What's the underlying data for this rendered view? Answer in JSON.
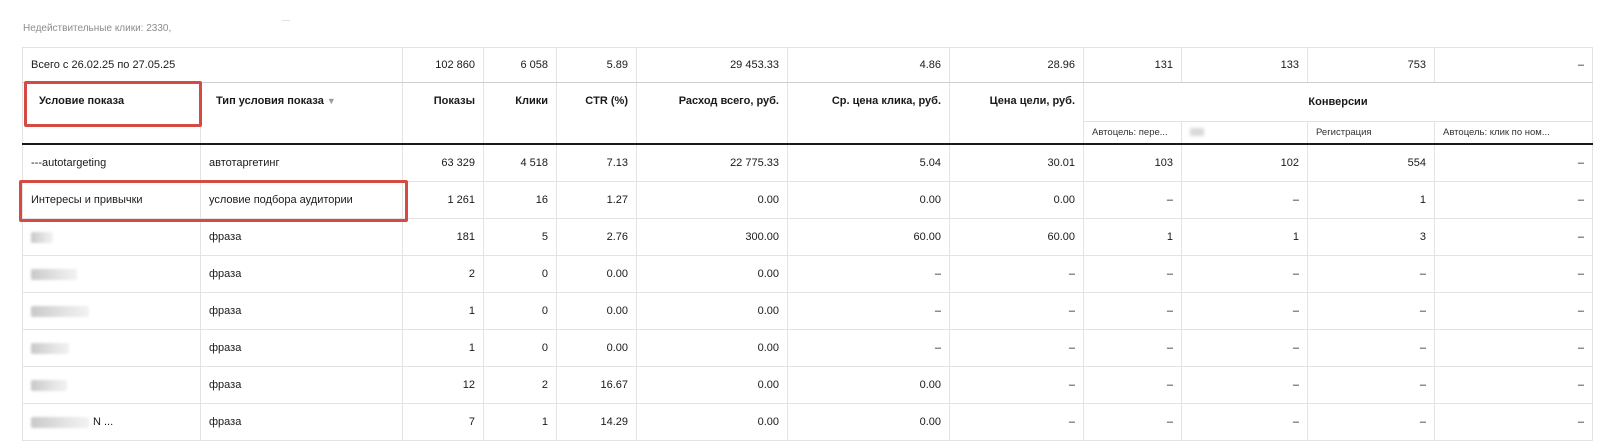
{
  "invalid_clicks": "Недействительные клики: 2330,",
  "totals": {
    "label": "Всего с 26.02.25 по 27.05.25",
    "impressions": "102 860",
    "clicks": "6 058",
    "ctr": "5.89",
    "spend": "29 453.33",
    "avg_cpc": "4.86",
    "goal_price": "28.96",
    "conv1": "131",
    "conv2": "133",
    "conv3": "753",
    "conv4": "–"
  },
  "headers": {
    "condition": "Условие показа",
    "condition_type": "Тип условия показа",
    "sort_arrow": "▼",
    "impressions": "Показы",
    "clicks": "Клики",
    "ctr": "CTR (%)",
    "spend": "Расход всего, руб.",
    "avg_cpc": "Ср. цена клика, руб.",
    "goal_price": "Цена цели, руб.",
    "conversions": "Конверсии",
    "conv_cols": [
      "Автоцель: пере...",
      "",
      "Регистрация",
      "Автоцель: клик по ном..."
    ]
  },
  "rows": [
    {
      "condition": "---autotargeting",
      "type": "автотаргетинг",
      "impressions": "63 329",
      "clicks": "4 518",
      "ctr": "7.13",
      "spend": "22 775.33",
      "avg_cpc": "5.04",
      "goal_price": "30.01",
      "c1": "103",
      "c2": "102",
      "c3": "554",
      "c4": "–"
    },
    {
      "condition": "Интересы и привычки",
      "type": "условие подбора аудитории",
      "impressions": "1 261",
      "clicks": "16",
      "ctr": "1.27",
      "spend": "0.00",
      "avg_cpc": "0.00",
      "goal_price": "0.00",
      "c1": "–",
      "c2": "–",
      "c3": "1",
      "c4": "–"
    },
    {
      "condition": "",
      "type": "фраза",
      "impressions": "181",
      "clicks": "5",
      "ctr": "2.76",
      "spend": "300.00",
      "avg_cpc": "60.00",
      "goal_price": "60.00",
      "c1": "1",
      "c2": "1",
      "c3": "3",
      "c4": "–"
    },
    {
      "condition": "",
      "type": "фраза",
      "impressions": "2",
      "clicks": "0",
      "ctr": "0.00",
      "spend": "0.00",
      "avg_cpc": "–",
      "goal_price": "–",
      "c1": "–",
      "c2": "–",
      "c3": "–",
      "c4": "–"
    },
    {
      "condition": "",
      "type": "фраза",
      "impressions": "1",
      "clicks": "0",
      "ctr": "0.00",
      "spend": "0.00",
      "avg_cpc": "–",
      "goal_price": "–",
      "c1": "–",
      "c2": "–",
      "c3": "–",
      "c4": "–"
    },
    {
      "condition": "",
      "type": "фраза",
      "impressions": "1",
      "clicks": "0",
      "ctr": "0.00",
      "spend": "0.00",
      "avg_cpc": "–",
      "goal_price": "–",
      "c1": "–",
      "c2": "–",
      "c3": "–",
      "c4": "–"
    },
    {
      "condition": "",
      "type": "фраза",
      "impressions": "12",
      "clicks": "2",
      "ctr": "16.67",
      "spend": "0.00",
      "avg_cpc": "0.00",
      "goal_price": "–",
      "c1": "–",
      "c2": "–",
      "c3": "–",
      "c4": "–"
    },
    {
      "condition": "N ...",
      "type": "фраза",
      "impressions": "7",
      "clicks": "1",
      "ctr": "14.29",
      "spend": "0.00",
      "avg_cpc": "0.00",
      "goal_price": "–",
      "c1": "–",
      "c2": "–",
      "c3": "–",
      "c4": "–"
    }
  ],
  "colors": {
    "highlight": "#d54a43",
    "border": "#e3e3e3",
    "muted_text": "#8c8c8c"
  }
}
